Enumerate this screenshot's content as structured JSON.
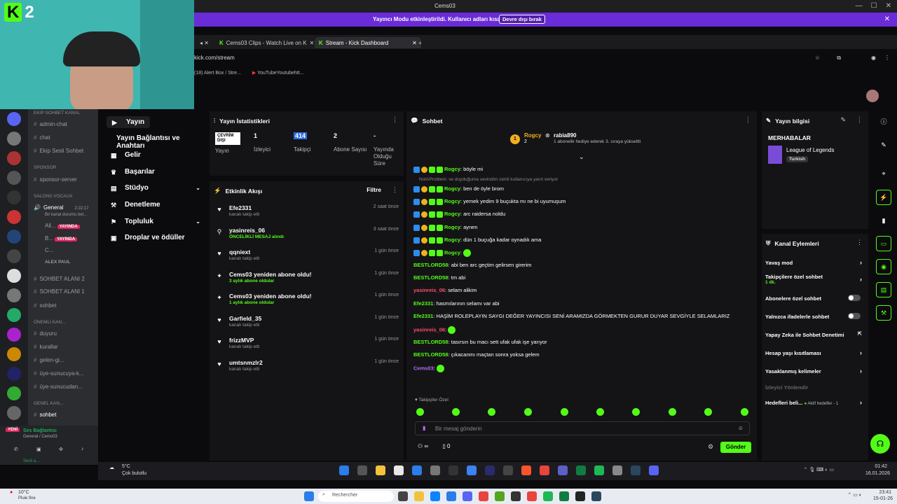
{
  "window": {
    "title": "Cems03"
  },
  "streamer_bar": {
    "message": "Yayıncı Modu etkinleştirildi. Kullanıcı adları kısaltıldı.",
    "button": "Devre dışı bırak"
  },
  "browser": {
    "tabs": [
      {
        "label": "Cems03 Clips - Watch Live on K"
      },
      {
        "label": "Stream - Kick Dashboard"
      }
    ],
    "url": "kick.com/stream",
    "bookmarks": [
      "(18) Alert Box / Stre...",
      "YouTubeYoutubehtt..."
    ]
  },
  "discord": {
    "channels": [
      {
        "label": "Ekip Sohbet Kanal",
        "type": "category"
      },
      {
        "label": "admin-chat",
        "type": "text"
      },
      {
        "label": "chat",
        "type": "text"
      },
      {
        "label": "Ekip Sesli Sohbet",
        "type": "text"
      },
      {
        "label": "SPONSOR",
        "type": "category"
      },
      {
        "label": "sponsor-server",
        "type": "text"
      },
      {
        "label": "Salons vocaux",
        "type": "category"
      },
      {
        "label": "General",
        "type": "voice"
      },
      {
        "label": "Bir kanal durumu bel...",
        "type": "status"
      },
      {
        "label": "SOHBET ALANI 2",
        "type": "voice"
      },
      {
        "label": "SOHBET ALANI 1",
        "type": "voice"
      },
      {
        "label": "sohbet",
        "type": "text"
      },
      {
        "label": "ÖNEMLİ KAN...",
        "type": "category"
      },
      {
        "label": "duyuru",
        "type": "text"
      },
      {
        "label": "kurallar",
        "type": "text"
      },
      {
        "label": "gelen-gi...",
        "type": "text"
      },
      {
        "label": "üye-sunucuya-k...",
        "type": "text"
      },
      {
        "label": "üye-sunucudan...",
        "type": "text"
      },
      {
        "label": "GENEL KAN...",
        "type": "category"
      },
      {
        "label": "sohbet",
        "type": "text"
      }
    ],
    "voice_time": "2:22:17",
    "live_badge": "YAYINDA",
    "voice_users": [
      "All...",
      "B...",
      "C...",
      "ALEX PAUL"
    ],
    "voice_status": "Ses Bağlantısı",
    "voice_sub": "General / Cems03",
    "new_badge": "YENİ",
    "user_status": "Sesli a..."
  },
  "kick_nav": {
    "items": [
      {
        "label": "Yayın"
      },
      {
        "label": "Yayın Bağlantısı ve Anahtarı"
      },
      {
        "label": "Gelir"
      },
      {
        "label": "Başarılar"
      },
      {
        "label": "Stüdyo"
      },
      {
        "label": "Denetleme"
      },
      {
        "label": "Topluluk"
      },
      {
        "label": "Droplar ve ödüller"
      }
    ]
  },
  "stats": {
    "title": "Yayın İstatistikleri",
    "offline_badge": "ÇEVRİM DIŞI",
    "items": [
      {
        "value": "",
        "label": "Yayın"
      },
      {
        "value": "1",
        "label": "İzleyici"
      },
      {
        "value": "414",
        "label": "Takipçi"
      },
      {
        "value": "2",
        "label": "Abone Sayısı"
      },
      {
        "value": "-",
        "label": "Yayında Olduğu Süre"
      }
    ]
  },
  "activity": {
    "title": "Etkinlik Akışı",
    "filter": "Filtre",
    "items": [
      {
        "icon": "heart",
        "name": "Efe2331",
        "sub": "kanalı takip etti",
        "time": "2 saat önce"
      },
      {
        "icon": "pin",
        "name": "yasinreis_06",
        "sub": "ÖNCELİKLİ MESAJ alındı",
        "time": "3 saat önce"
      },
      {
        "icon": "heart",
        "name": "qqniext",
        "sub": "kanalı takip etti",
        "time": "1 gün önce"
      },
      {
        "icon": "star",
        "name": "Cems03 yeniden abone oldu!",
        "sub": "3 aylık abone oldular",
        "time": "1 gün önce"
      },
      {
        "icon": "star",
        "name": "Cems03 yeniden abone oldu!",
        "sub": "1 aylık abone oldular",
        "time": "1 gün önce"
      },
      {
        "icon": "heart",
        "name": "Garfield_35",
        "sub": "kanalı takip etti",
        "time": "1 gün önce"
      },
      {
        "icon": "heart",
        "name": "frizzMVP",
        "sub": "kanalı takip etti",
        "time": "1 gün önce"
      },
      {
        "icon": "heart",
        "name": "umtsnmzlr2",
        "sub": "kanalı takip etti",
        "time": "1 gün önce"
      }
    ]
  },
  "chat": {
    "title": "Sohbet",
    "pinned": {
      "user": "Rogcy",
      "user2": "rabia890",
      "rank": "2",
      "badge": "1",
      "text": "1 abonelik hediye ederek 3. sıraya yükseltti"
    },
    "reply_hint": "NotAProblem: ve duyduğuma sevindim isimli kullanıcıya yanıt veriyor",
    "messages": [
      {
        "user": "Rogcy",
        "color": "green",
        "badges": true,
        "text": "böyle mi"
      },
      {
        "user": "Rogcy",
        "color": "green",
        "badges": true,
        "text": "ben de öyle brom"
      },
      {
        "user": "Rogcy",
        "color": "green",
        "badges": true,
        "text": "yemek yedim 9 buçukta mı ne bi uyumuşum"
      },
      {
        "user": "Rogcy",
        "color": "green",
        "badges": true,
        "text": "arc raidersa noldu"
      },
      {
        "user": "Rogcy",
        "color": "green",
        "badges": true,
        "text": "aynen"
      },
      {
        "user": "Rogcy",
        "color": "green",
        "badges": true,
        "text": "dün 1 buçuğa kadar oynadık ama"
      },
      {
        "user": "Rogcy",
        "color": "green",
        "badges": true,
        "text": ""
      },
      {
        "user": "BESTLORD58",
        "color": "green",
        "badges": false,
        "text": "abi ben arc geçtim gelirsen girerim"
      },
      {
        "user": "BESTLORD58",
        "color": "green",
        "badges": false,
        "text": "tm abi"
      },
      {
        "user": "yasinreis_06",
        "color": "red",
        "badges": false,
        "text": "selam alikim"
      },
      {
        "user": "Efe2331",
        "color": "green",
        "badges": false,
        "text": "hasmılarının selamı var abi"
      },
      {
        "user": "Efe2331",
        "color": "green",
        "badges": false,
        "text": "HAŞİM ROLEPLAYIN SAYGI DEĞER YAYINCISI SENİ ARAMIZDA GÖRMEKTEN GURUR DUYAR SEVGİYLE SELAMLARIZ"
      },
      {
        "user": "yasinreis_06",
        "color": "red",
        "badges": false,
        "text": ""
      },
      {
        "user": "BESTLORD58",
        "color": "green",
        "badges": false,
        "text": "tasırsın bu macı sett ufak ufak işe yarıyor"
      },
      {
        "user": "BESTLORD58",
        "color": "green",
        "badges": false,
        "text": "çıkacanmı maçtan sonra yoksa gelem"
      },
      {
        "user": "Cems03",
        "color": "purple",
        "badges": false,
        "text": ""
      }
    ],
    "emote_label": "Takipçiler Özel",
    "input_placeholder": "Bir mesaj gönderin",
    "count": "0",
    "send": "Gönder"
  },
  "stream_info": {
    "title": "Yayın bilgisi",
    "stream_title": "MERHABALAR",
    "category": "League of Legends",
    "language": "Turkish"
  },
  "channel_actions": {
    "title": "Kanal Eylemleri",
    "items": [
      {
        "label": "Yavaş mod",
        "kind": "arrow"
      },
      {
        "label": "Takipçilere özel sohbet",
        "sub": "1 dk.",
        "kind": "arrow"
      },
      {
        "label": "Abonelere özel sohbet",
        "kind": "toggle"
      },
      {
        "label": "Yalnızca ifadelerle sohbet",
        "kind": "toggle"
      },
      {
        "label": "Yapay Zeka ile Sohbet Denetimi",
        "kind": "link"
      },
      {
        "label": "Hesap yaşı kısıtlaması",
        "kind": "arrow"
      },
      {
        "label": "Yasaklanmış kelimeler",
        "kind": "arrow"
      },
      {
        "label": "İzleyici Yönlendir",
        "kind": "none"
      },
      {
        "label": "Hedefleri beli...",
        "sub": "Aktif hedefler - 1",
        "kind": "arrow"
      }
    ]
  },
  "inner_taskbar": {
    "weather_temp": "5°C",
    "weather_text": "Çok bulutlu",
    "time": "01:42",
    "date": "16.01.2026"
  },
  "outer_taskbar": {
    "weather_temp": "10°C",
    "weather_text": "Pluie fine",
    "search": "Rechercher",
    "time": "23:41",
    "date": "15-01-26"
  },
  "colors": {
    "kick_green": "#53fc18",
    "streamer_purple": "#6a2bd8",
    "live_red": "#e0245e"
  }
}
